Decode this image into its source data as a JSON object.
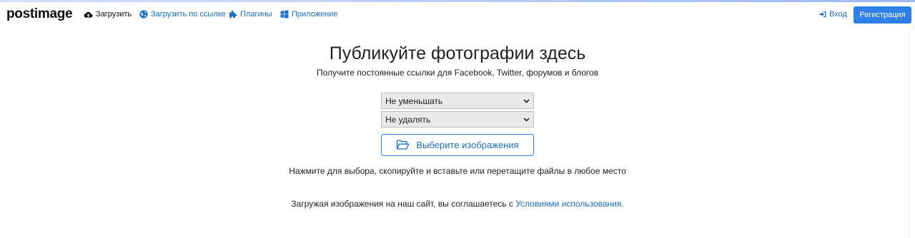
{
  "nav": {
    "logo": "postimage",
    "upload": {
      "label": "Загрузить",
      "icon": "cloud-upload-icon"
    },
    "upload_by_link": {
      "label": "Загрузить по ссылке",
      "icon": "globe-icon"
    },
    "plugins": {
      "label": "Плагины",
      "icon": "puzzle-icon"
    },
    "app": {
      "label": "Приложение",
      "icon": "windows-icon"
    },
    "login": {
      "label": "Вход",
      "icon": "sign-in-icon"
    },
    "register": {
      "label": "Регистрация"
    }
  },
  "hero": {
    "title": "Публикуйте фотографии здесь",
    "subtitle": "Получите постоянные ссылки для Facebook, Twitter, форумов и блогов"
  },
  "form": {
    "resize_select": {
      "value": "Не уменьшать"
    },
    "expire_select": {
      "value": "Не удалять"
    },
    "choose_button": {
      "label": "Выберите изображения",
      "icon": "folder-open-icon"
    },
    "hint": "Нажмите для выбора, скопируйте и вставьте или перетащите файлы в любое место"
  },
  "terms": {
    "text": "Загружая изображения на наш сайт, вы соглашаетесь с ",
    "link": "Условиями использования."
  },
  "colors": {
    "accent": "#2f7fe8",
    "link": "#1a6fc9",
    "text": "#222222"
  }
}
